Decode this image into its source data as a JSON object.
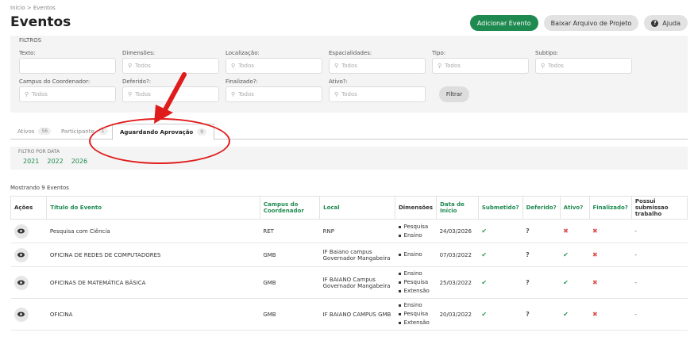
{
  "breadcrumb": "Início > Eventos",
  "page_title": "Eventos",
  "buttons": {
    "add": "Adicionar Evento",
    "download": "Baixar Arquivo de Projeto",
    "help": "Ajuda"
  },
  "filters": {
    "title": "FILTROS",
    "texto": "Texto:",
    "dimensoes": "Dimensões:",
    "localizacao": "Localização:",
    "especialidades": "Espacialidades:",
    "tipo": "Tipo:",
    "subtipo": "Subtipo:",
    "campus": "Campus do Coordenador:",
    "deferido": "Deferido?:",
    "finalizado": "Finalizado?:",
    "ativo": "Ativo?:",
    "placeholder": "Todos",
    "filter_button": "Filtrar"
  },
  "tabs": [
    {
      "label": "Ativos",
      "count": "56"
    },
    {
      "label": "Participante",
      "count": "1"
    },
    {
      "label": "Aguardando Aprovação",
      "count": "9"
    }
  ],
  "date_filter": {
    "label": "FILTRO POR DATA",
    "years": [
      "2021",
      "2022",
      "2026"
    ]
  },
  "showing": "Mostrando 9 Eventos",
  "table": {
    "headers": [
      "Ações",
      "Título do Evento",
      "Campus do Coordenador",
      "Local",
      "Dimensões",
      "Data de Início",
      "Submetido?",
      "Deferido?",
      "Ativo?",
      "Finalizado?",
      "Possui submissao trabalho"
    ],
    "rows": [
      {
        "title": "Pesquisa com Ciência",
        "campus": "RET",
        "local": "RNP",
        "dims": [
          "Pesquisa",
          "Ensino"
        ],
        "date": "24/03/2026",
        "submetido": "ok",
        "deferido": "q",
        "ativo": "no",
        "finalizado": "no",
        "possui": "-"
      },
      {
        "title": "OFICINA DE REDES DE COMPUTADORES",
        "campus": "GMB",
        "local": "IF Baiano campus Governador Mangabeira",
        "dims": [
          "Ensino"
        ],
        "date": "07/03/2022",
        "submetido": "ok",
        "deferido": "q",
        "ativo": "ok",
        "finalizado": "no",
        "possui": "-"
      },
      {
        "title": "OFICINAS DE MATEMÁTICA BÁSICA",
        "campus": "GMB",
        "local": "IF BAIANO Campus Governador Mangabeira",
        "dims": [
          "Ensino",
          "Pesquisa",
          "Extensão"
        ],
        "date": "25/03/2022",
        "submetido": "ok",
        "deferido": "q",
        "ativo": "ok",
        "finalizado": "no",
        "possui": "-"
      },
      {
        "title": "OFICINA",
        "campus": "GMB",
        "local": "IF BAIANO CAMPUS GMB",
        "dims": [
          "Ensino",
          "Pesquisa",
          "Extensão"
        ],
        "date": "20/03/2022",
        "submetido": "ok",
        "deferido": "q",
        "ativo": "ok",
        "finalizado": "no",
        "possui": "-"
      }
    ]
  }
}
